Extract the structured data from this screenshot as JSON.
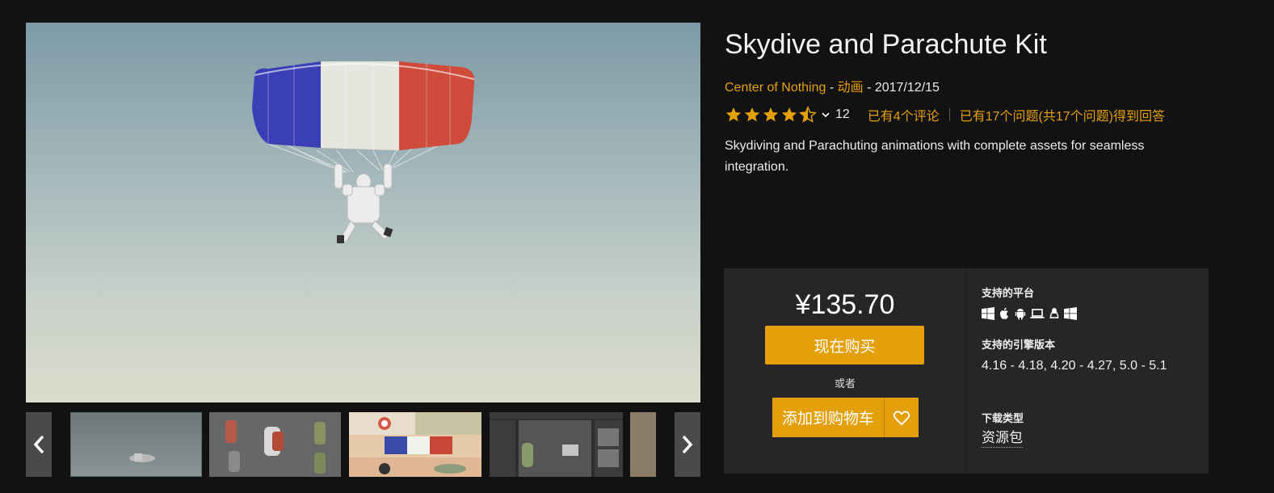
{
  "product": {
    "title": "Skydive and Parachute Kit",
    "author": "Center of Nothing",
    "category": "动画",
    "date": "2017/12/15",
    "separator": " - ",
    "rating_value": 4.5,
    "rating_count": "12",
    "reviews_link": "已有4个评论",
    "questions_link": "已有17个问题(共17个问题)得到回答",
    "description": "Skydiving and Parachuting animations with complete assets for seamless integration."
  },
  "purchase": {
    "price": "¥135.70",
    "buy_label": "现在购买",
    "or_label": "或者",
    "cart_label": "添加到购物车"
  },
  "specs": {
    "platforms_label": "支持的平台",
    "platforms": [
      "windows-icon",
      "apple-icon",
      "android-icon",
      "laptop-icon",
      "linux-icon",
      "windows-icon"
    ],
    "engine_label": "支持的引擎版本",
    "engine_versions": "4.16 - 4.18, 4.20 - 4.27, 5.0 - 5.1",
    "download_label": "下载类型",
    "download_type": "资源包"
  },
  "gallery": {
    "thumbnails": [
      "thumb-1",
      "thumb-2",
      "thumb-3",
      "thumb-4",
      "thumb-5"
    ]
  },
  "colors": {
    "background": "#121212",
    "accent": "#e3a00b",
    "panel": "#262626"
  }
}
